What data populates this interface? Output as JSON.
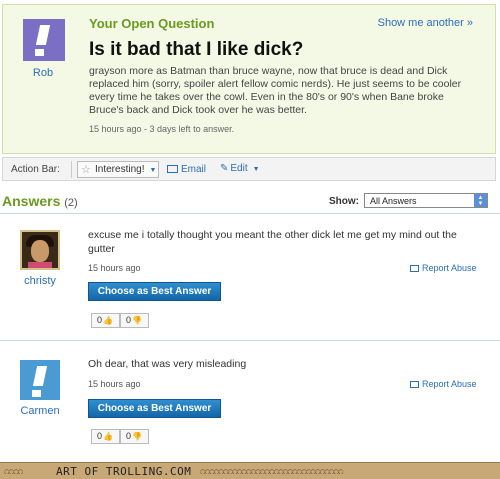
{
  "question": {
    "heading": "Your Open Question",
    "show_another": "Show me another »",
    "user": "Rob",
    "title": "Is it bad that I like dick?",
    "body": "grayson more as Batman than bruce wayne, now that bruce is dead and Dick replaced him (sorry, spoiler alert fellow comic nerds). He just seems to be cooler every time he takes over the cowl. Even in the 80's or 90's when Bane broke Bruce's back and Dick took over he was better.",
    "meta": "15 hours ago - 3 days left to answer."
  },
  "action_bar": {
    "label": "Action Bar:",
    "interesting": "Interesting!",
    "email": "Email",
    "edit": "Edit"
  },
  "answers_header": {
    "title": "Answers",
    "count": "(2)",
    "show_label": "Show:",
    "show_value": "All Answers"
  },
  "answers": [
    {
      "user": "christy",
      "text": "excuse me i totally thought you meant the other dick let me get my mind out the gutter",
      "time": "15 hours ago",
      "report": "Report Abuse",
      "best": "Choose as Best Answer",
      "thumbs_up": "0",
      "thumbs_down": "0"
    },
    {
      "user": "Carmen",
      "text": "Oh dear, that was very misleading",
      "time": "15 hours ago",
      "report": "Report Abuse",
      "best": "Choose as Best Answer",
      "thumbs_up": "0",
      "thumbs_down": "0"
    }
  ],
  "footer": {
    "text": "ART OF TROLLING.COM"
  },
  "colors": {
    "accent_green": "#6a9a1f",
    "link_blue": "#2a6fb8",
    "button_blue": "#1466a8"
  }
}
